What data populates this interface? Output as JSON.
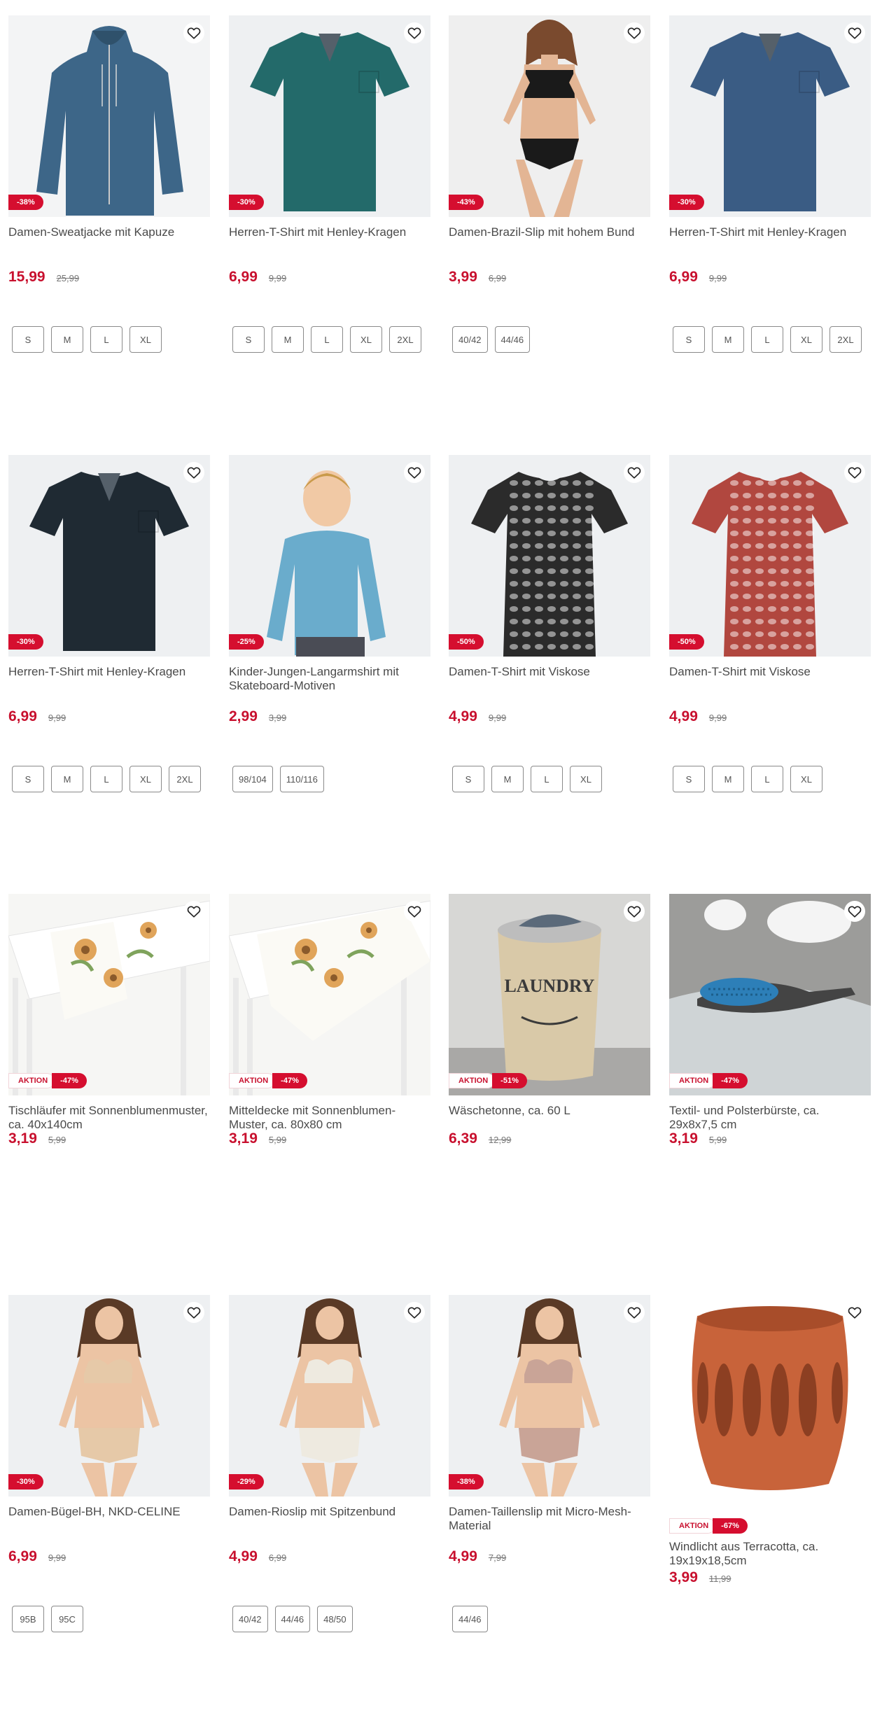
{
  "products": [
    {
      "title": "Damen-Sweatjacke mit Kapuze",
      "price": "15,99",
      "old_price": "25,99",
      "discount": "-38%",
      "aktion": "",
      "sizes": [
        "S",
        "M",
        "L",
        "XL"
      ],
      "image": "hoodie-jacket",
      "color": "#3d6688"
    },
    {
      "title": "Herren-T-Shirt mit Henley-Kragen",
      "price": "6,99",
      "old_price": "9,99",
      "discount": "-30%",
      "aktion": "",
      "sizes": [
        "S",
        "M",
        "L",
        "XL",
        "2XL"
      ],
      "image": "tshirt",
      "color": "#236a6a"
    },
    {
      "title": "Damen-Brazil-Slip mit hohem Bund",
      "price": "3,99",
      "old_price": "6,99",
      "discount": "-43%",
      "aktion": "",
      "sizes": [
        "40/42",
        "44/46"
      ],
      "image": "model-underwear",
      "color": "#1a1a1a"
    },
    {
      "title": "Herren-T-Shirt mit Henley-Kragen",
      "price": "6,99",
      "old_price": "9,99",
      "discount": "-30%",
      "aktion": "",
      "sizes": [
        "S",
        "M",
        "L",
        "XL",
        "2XL"
      ],
      "image": "tshirt",
      "color": "#3a5c84"
    },
    {
      "title": "Herren-T-Shirt mit Henley-Kragen",
      "price": "6,99",
      "old_price": "9,99",
      "discount": "-30%",
      "aktion": "",
      "sizes": [
        "S",
        "M",
        "L",
        "XL",
        "2XL"
      ],
      "image": "tshirt",
      "color": "#1f2a33"
    },
    {
      "title": "Kinder-Jungen-Langarmshirt mit Skateboard-Motiven",
      "price": "2,99",
      "old_price": "3,99",
      "discount": "-25%",
      "aktion": "",
      "sizes": [
        "98/104",
        "110/116"
      ],
      "image": "kid-longsleeve",
      "color": "#6aaccc"
    },
    {
      "title": "Damen-T-Shirt mit Viskose",
      "price": "4,99",
      "old_price": "9,99",
      "discount": "-50%",
      "aktion": "",
      "sizes": [
        "S",
        "M",
        "L",
        "XL"
      ],
      "image": "pattern-tshirt",
      "color": "#2b2b2b"
    },
    {
      "title": "Damen-T-Shirt mit Viskose",
      "price": "4,99",
      "old_price": "9,99",
      "discount": "-50%",
      "aktion": "",
      "sizes": [
        "S",
        "M",
        "L",
        "XL"
      ],
      "image": "pattern-tshirt",
      "color": "#b1473f"
    },
    {
      "title": "Tischläufer mit Sonnenblumenmuster, ca. 40x140cm",
      "price": "3,19",
      "old_price": "5,99",
      "discount": "-47%",
      "aktion": "AKTION",
      "sizes": [],
      "image": "table-runner",
      "color": "#e0a45a"
    },
    {
      "title": "Mitteldecke mit Sonnenblumen-Muster, ca. 80x80 cm",
      "price": "3,19",
      "old_price": "5,99",
      "discount": "-47%",
      "aktion": "AKTION",
      "sizes": [],
      "image": "table-cloth",
      "color": "#e0a45a"
    },
    {
      "title": "Wäschetonne, ca. 60 L",
      "price": "6,39",
      "old_price": "12,99",
      "discount": "-51%",
      "aktion": "AKTION",
      "sizes": [],
      "image": "laundry-basket",
      "color": "#d9c9a8"
    },
    {
      "title": "Textil- und Polsterbürste, ca. 29x8x7,5 cm",
      "price": "3,19",
      "old_price": "5,99",
      "discount": "-47%",
      "aktion": "AKTION",
      "sizes": [],
      "image": "brush",
      "color": "#2d7fb8"
    },
    {
      "title": "Damen-Bügel-BH, NKD-CELINE",
      "price": "6,99",
      "old_price": "9,99",
      "discount": "-30%",
      "aktion": "",
      "sizes": [
        "95B",
        "95C"
      ],
      "image": "model-bra",
      "color": "#e6c9a8"
    },
    {
      "title": "Damen-Rioslip mit Spitzenbund",
      "price": "4,99",
      "old_price": "6,99",
      "discount": "-29%",
      "aktion": "",
      "sizes": [
        "40/42",
        "44/46",
        "48/50"
      ],
      "image": "model-bra",
      "color": "#eeeae0"
    },
    {
      "title": "Damen-Taillenslip mit Micro-Mesh-Material",
      "price": "4,99",
      "old_price": "7,99",
      "discount": "-38%",
      "aktion": "",
      "sizes": [
        "44/46"
      ],
      "image": "model-bra",
      "color": "#c9a497"
    },
    {
      "title": "Windlicht aus Terracotta, ca. 19x19x18,5cm",
      "price": "3,99",
      "old_price": "11,99",
      "discount": "-67%",
      "aktion": "AKTION",
      "sizes": [],
      "image": "terracotta-lantern",
      "color": "#c8633a"
    }
  ],
  "icons": {
    "favorite": "heart-outline-icon"
  }
}
